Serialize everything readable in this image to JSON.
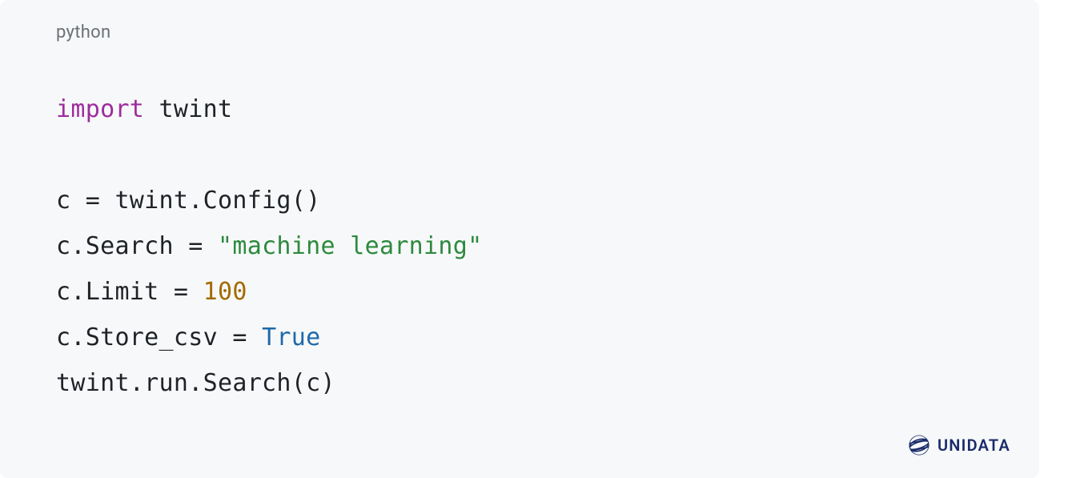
{
  "code_block": {
    "language_label": "python",
    "tokens": [
      [
        {
          "cls": "tok-keyword",
          "t": "import"
        },
        {
          "cls": "tok-plain",
          "t": " twint"
        }
      ],
      [
        {
          "cls": "tok-plain",
          "t": ""
        }
      ],
      [
        {
          "cls": "tok-plain",
          "t": "c = twint.Config()"
        }
      ],
      [
        {
          "cls": "tok-plain",
          "t": "c.Search = "
        },
        {
          "cls": "tok-string",
          "t": "\"machine learning\""
        }
      ],
      [
        {
          "cls": "tok-plain",
          "t": "c.Limit = "
        },
        {
          "cls": "tok-number",
          "t": "100"
        }
      ],
      [
        {
          "cls": "tok-plain",
          "t": "c.Store_csv = "
        },
        {
          "cls": "tok-bool",
          "t": "True"
        }
      ],
      [
        {
          "cls": "tok-plain",
          "t": "twint.run.Search(c)"
        }
      ]
    ]
  },
  "watermark": {
    "label": "UNIDATA",
    "icon_name": "globe-sphere-icon"
  },
  "colors": {
    "bg": "#f7f8f9",
    "keyword": "#9d2c9e",
    "string": "#2d8a3e",
    "number": "#a36b00",
    "bool": "#1d69ab",
    "text": "#1f2328",
    "label": "#6b7075",
    "brand": "#1a2b6b"
  }
}
